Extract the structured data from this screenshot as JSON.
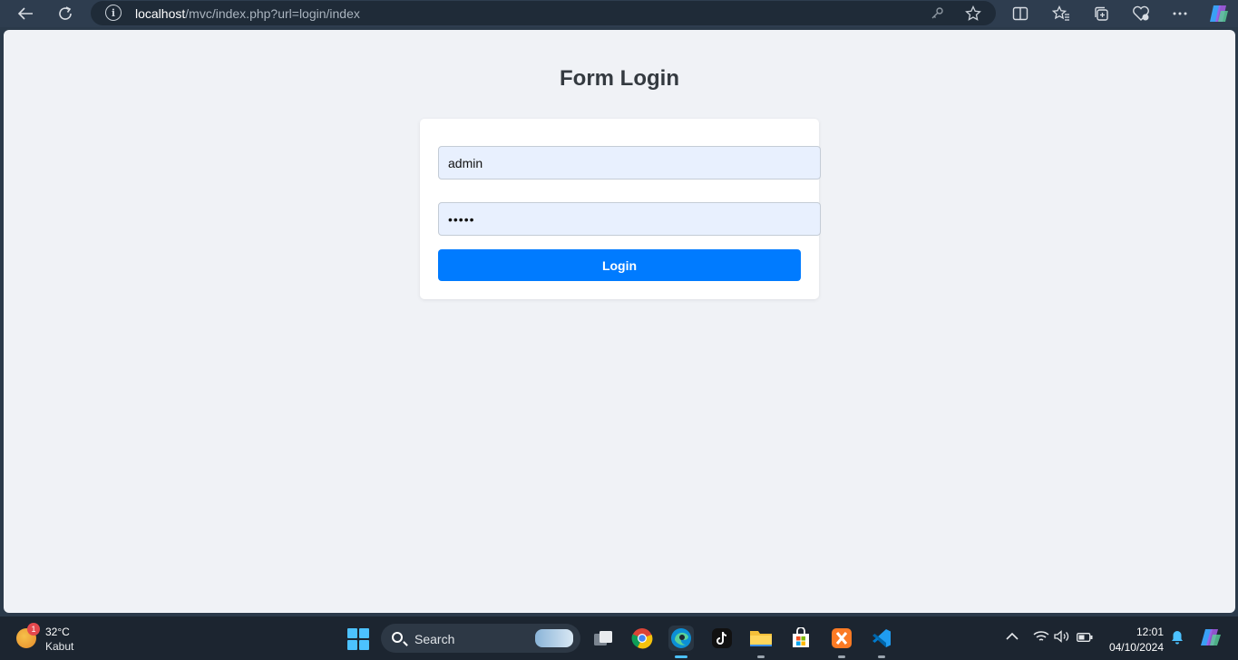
{
  "browser": {
    "url_host": "localhost",
    "url_path": "/mvc/index.php?url=login/index"
  },
  "page": {
    "title": "Form Login",
    "username_value": "admin",
    "password_value": "admin",
    "login_button": "Login"
  },
  "taskbar": {
    "weather_temp": "32°C",
    "weather_condition": "Kabut",
    "weather_badge": "1",
    "search_label": "Search",
    "time": "12:01",
    "date": "04/10/2024",
    "accent_color": "#4cc2ff"
  },
  "colors": {
    "button": "#007bff",
    "page_background": "#f0f2f6",
    "input_background": "#e8f0fe"
  }
}
